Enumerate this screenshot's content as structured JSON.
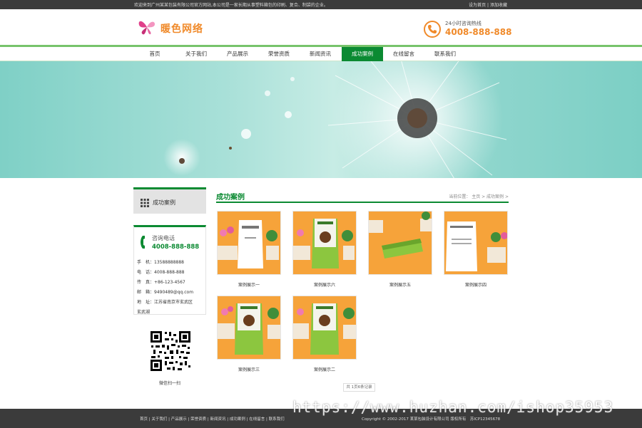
{
  "topbar": {
    "welcome": "欢迎来到广州某某包装有限公司官方网站,本公司是一家长期从事塑料箱包的印刷、复合、制袋的企业。",
    "link_home": "设为首页",
    "sep": " | ",
    "link_fav": "添加收藏"
  },
  "header": {
    "logo_text": "暖色网络",
    "hotline_label": "24小时咨询热线",
    "hotline_number": "4008-888-888"
  },
  "nav": {
    "items": [
      "首页",
      "关于我们",
      "产品展示",
      "荣誉资质",
      "新闻资讯",
      "成功案例",
      "在线留言",
      "联系我们"
    ],
    "active_index": 5
  },
  "sidebar": {
    "title": "成功案例",
    "contact_label": "咨询电话",
    "contact_number": "4008-888-888",
    "rows": [
      "手　机：13588888888",
      "电　话：4008-888-888",
      "传　真：+86-123-4567",
      "邮　箱：9490489@qq.com",
      "地　址：江苏省南京市玄武区",
      "玄武湖"
    ],
    "qr_caption": "微信扫一扫"
  },
  "content": {
    "title": "成功案例",
    "breadcrumb": "当前位置： 主页 > 成功案例 >",
    "cases": [
      {
        "caption": "案例展示一"
      },
      {
        "caption": "案例展示六"
      },
      {
        "caption": "案例展示五"
      },
      {
        "caption": "案例展示四"
      },
      {
        "caption": "案例展示三"
      },
      {
        "caption": "案例展示二"
      }
    ],
    "pager": "共 1页6条记录"
  },
  "footer": {
    "links": [
      "首页",
      "关于我们",
      "产品展示",
      "荣誉资质",
      "新闻资讯",
      "成功案例",
      "在线留言",
      "联系我们"
    ],
    "copyright": "Copyright © 2002-2017 某某包装设计有限公司 版权所有　苏ICP12345678"
  },
  "watermark": "https://www.huzhan.com/ishop35953",
  "colors": {
    "accent_green": "#0b8a32",
    "nav_border": "#77c36b",
    "accent_orange": "#f08a2a",
    "dark_bar": "#3b3b3b"
  }
}
